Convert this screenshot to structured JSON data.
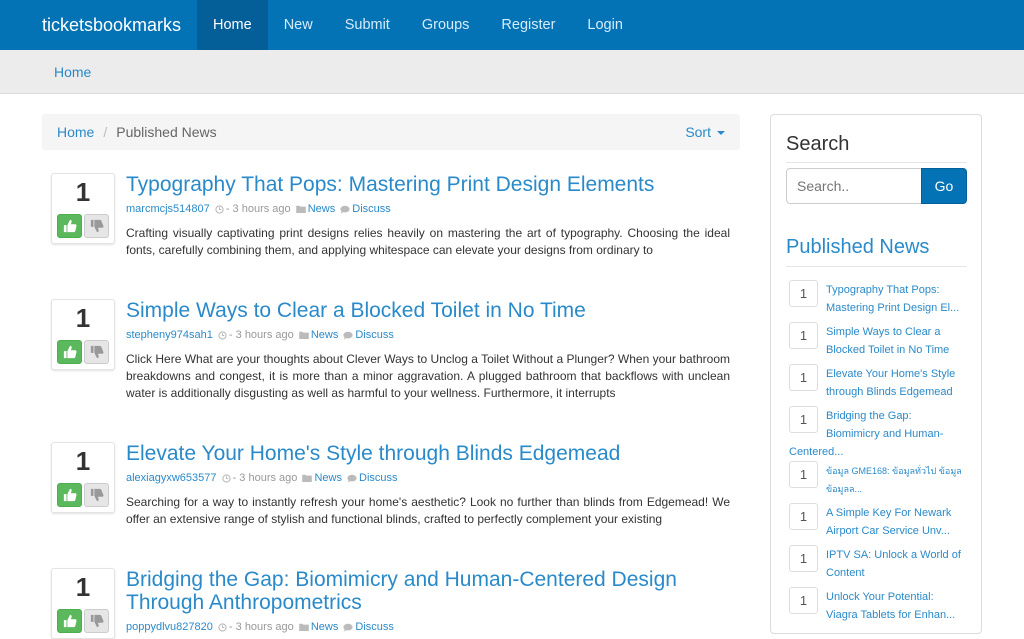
{
  "navbar": {
    "brand": "ticketsbookmarks",
    "items": [
      {
        "label": "Home",
        "active": true
      },
      {
        "label": "New"
      },
      {
        "label": "Submit"
      },
      {
        "label": "Groups"
      },
      {
        "label": "Register"
      },
      {
        "label": "Login"
      }
    ]
  },
  "subbar": {
    "home": "Home"
  },
  "breadcrumb": {
    "home": "Home",
    "separator": "/",
    "current": "Published News",
    "sort_label": "Sort"
  },
  "posts": [
    {
      "votes": "1",
      "title": "Typography That Pops: Mastering Print Design Elements",
      "author": "marcmcjs514807",
      "time": "- 3 hours ago",
      "category": "News",
      "discuss": "Discuss",
      "excerpt": "Crafting visually captivating print designs relies heavily on mastering the art of typography. Choosing the ideal fonts, carefully combining them, and applying whitespace can elevate your designs from ordinary to"
    },
    {
      "votes": "1",
      "title": "Simple Ways to Clear a Blocked Toilet in No Time",
      "author": "stepheny974sah1",
      "time": "- 3 hours ago",
      "category": "News",
      "discuss": "Discuss",
      "excerpt": "Click Here What are your thoughts about Clever Ways to Unclog a Toilet Without a Plunger? When your bathroom breakdowns and congest, it is more than a minor aggravation. A plugged bathroom that backflows with unclean water is additionally disgusting as well as harmful to your wellness. Furthermore, it interrupts"
    },
    {
      "votes": "1",
      "title": "Elevate Your Home's Style through Blinds Edgemead",
      "author": "alexiagyxw653577",
      "time": "- 3 hours ago",
      "category": "News",
      "discuss": "Discuss",
      "excerpt": "Searching for a way to instantly refresh your home's aesthetic? Look no further than blinds from Edgemead! We offer an extensive range of stylish and functional blinds, crafted to perfectly complement your existing"
    },
    {
      "votes": "1",
      "title": "Bridging the Gap: Biomimicry and Human-Centered Design Through Anthropometrics",
      "author": "poppydlvu827820",
      "time": "- 3 hours ago",
      "category": "News",
      "discuss": "Discuss",
      "excerpt": ""
    }
  ],
  "sidebar": {
    "search_heading": "Search",
    "search_placeholder": "Search..",
    "go_label": "Go",
    "published_heading": "Published News",
    "items": [
      {
        "count": "1",
        "title": "Typography That Pops: Mastering Print Design El..."
      },
      {
        "count": "1",
        "title": "Simple Ways to Clear a Blocked Toilet in No Time"
      },
      {
        "count": "1",
        "title": "Elevate Your Home's Style through Blinds Edgemead"
      },
      {
        "count": "1",
        "title": "Bridging the Gap: Biomimicry and Human-Centered..."
      },
      {
        "count": "1",
        "title": "ข้อมูล GME168: ข้อมูลทั่วไป ข้อมูล ข้อมูลล..."
      },
      {
        "count": "1",
        "title": "A Simple Key For Newark Airport Car Service Unv..."
      },
      {
        "count": "1",
        "title": "IPTV SA: Unlock a World of Content"
      },
      {
        "count": "1",
        "title": "Unlock Your Potential: Viagra Tablets for Enhan..."
      }
    ]
  },
  "colors": {
    "navbar": "#0473b6",
    "link": "#2a8ac9",
    "upvote": "#5cb85c"
  }
}
